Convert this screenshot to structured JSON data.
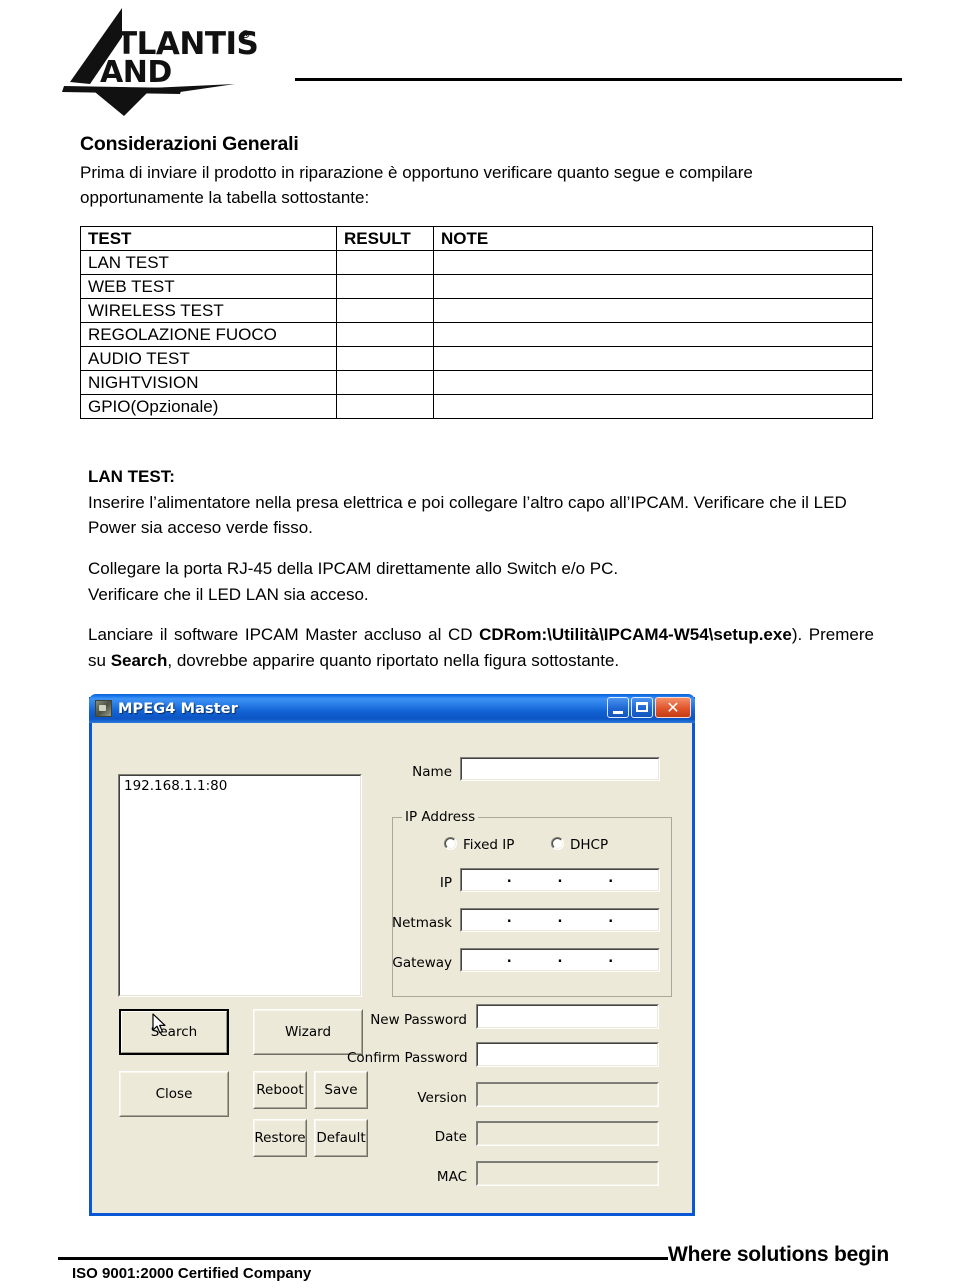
{
  "brand": {
    "logo_text": "ATLANTIS",
    "logo_sub": "LAND",
    "logo_mark": "atlantis-land-logo"
  },
  "section": {
    "title": "Considerazioni Generali",
    "intro": "Prima di inviare il prodotto in riparazione è opportuno verificare quanto segue e compilare opportunamente la tabella sottostante:"
  },
  "table": {
    "headers": [
      "TEST",
      "RESULT",
      "NOTE"
    ],
    "rows": [
      {
        "test": "LAN TEST",
        "result": "",
        "note": ""
      },
      {
        "test": "WEB TEST",
        "result": "",
        "note": ""
      },
      {
        "test": "WIRELESS TEST",
        "result": "",
        "note": ""
      },
      {
        "test": "REGOLAZIONE FUOCO",
        "result": "",
        "note": ""
      },
      {
        "test": "AUDIO TEST",
        "result": "",
        "note": ""
      },
      {
        "test": "NIGHTVISION",
        "result": "",
        "note": ""
      },
      {
        "test": "GPIO(Opzionale)",
        "result": "",
        "note": ""
      }
    ]
  },
  "paragraphs": {
    "lantest_heading": "LAN TEST:",
    "lantest_body": "Inserire l’alimentatore nella presa elettrica e poi collegare l’altro capo all’IPCAM. Verificare che il LED Power sia acceso verde fisso.",
    "rj45_line1": "Collegare la porta RJ-45 della IPCAM direttamente allo Switch e/o PC.",
    "rj45_line2": "Verificare che il LED LAN sia acceso.",
    "launch_part1": "Lanciare il software IPCAM Master accluso al CD ",
    "launch_bold1": "CDRom:\\Utilità\\IPCAM4-W54\\setup.exe",
    "launch_part2": "). Premere su ",
    "launch_bold2": "Search",
    "launch_part3": ", dovrebbe apparire quanto riportato nella figura sottostante."
  },
  "dialog": {
    "title": "MPEG4 Master",
    "icon": "camera-icon",
    "window_buttons": {
      "minimize": "minimize-icon",
      "maximize": "maximize-icon",
      "close": "✕"
    },
    "device_list": {
      "items": [
        "192.168.1.1:80"
      ]
    },
    "fields": {
      "name_label": "Name",
      "name_value": "",
      "ip_group_label": "IP Address",
      "fixed_ip_label": "Fixed IP",
      "dhcp_label": "DHCP",
      "ip_label": "IP",
      "ip_value": "",
      "netmask_label": "Netmask",
      "netmask_value": "",
      "gateway_label": "Gateway",
      "gateway_value": "",
      "new_password_label": "New Password",
      "new_password_value": "",
      "confirm_password_label": "Confirm Password",
      "confirm_password_value": "",
      "version_label": "Version",
      "version_value": "",
      "date_label": "Date",
      "date_value": "",
      "mac_label": "MAC",
      "mac_value": ""
    },
    "buttons": {
      "search": "Search",
      "wizard": "Wizard",
      "close": "Close",
      "reboot": "Reboot",
      "save": "Save",
      "restore": "Restore",
      "default": "Default"
    },
    "colors": {
      "titlebar": "#0b62d8",
      "client": "#ece9d8",
      "close_button": "#e0552a"
    }
  },
  "footer": {
    "iso": "ISO 9001:2000 Certified Company",
    "slogan": "Where solutions begin"
  }
}
